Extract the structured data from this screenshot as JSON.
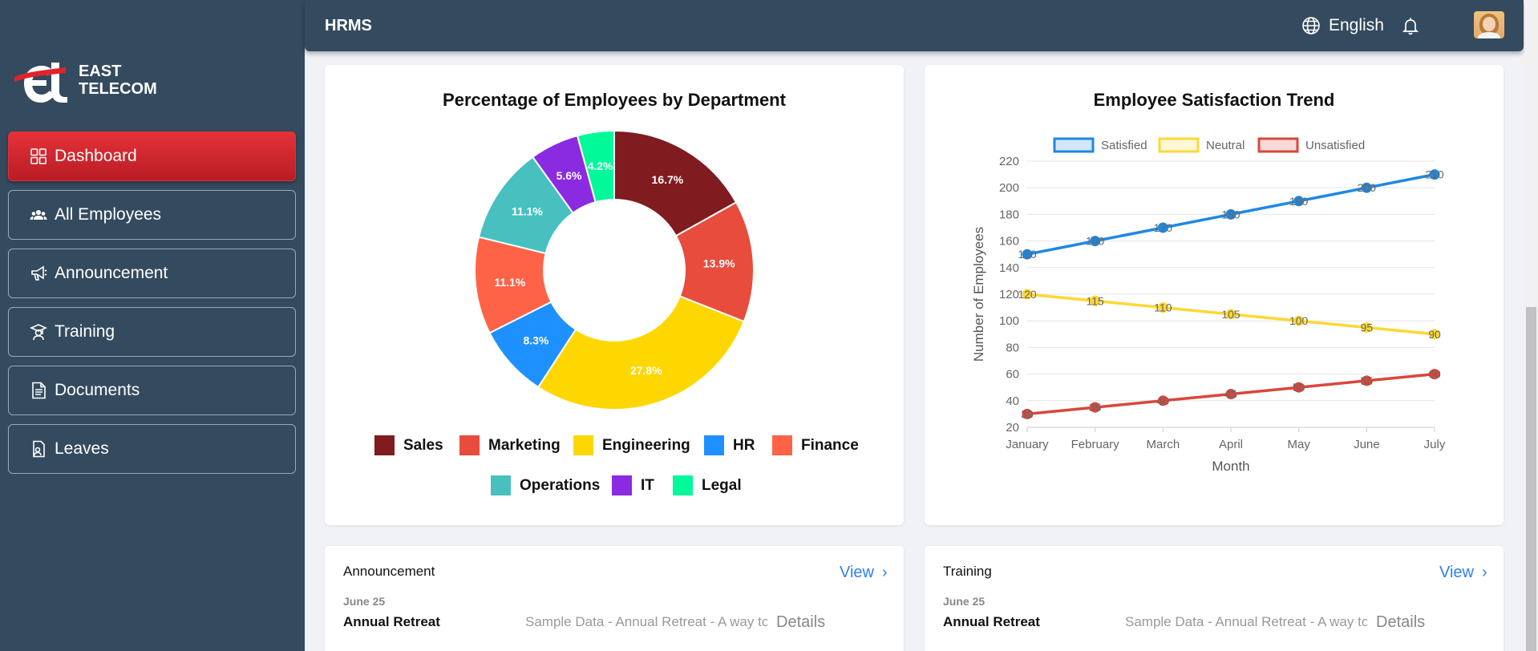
{
  "brand": {
    "line1": "EAST",
    "line2": "TELECOM",
    "accent": "#e2232a"
  },
  "sidebar": {
    "items": [
      {
        "label": "Dashboard",
        "icon": "grid-icon"
      },
      {
        "label": "All Employees",
        "icon": "users-icon"
      },
      {
        "label": "Announcement",
        "icon": "megaphone-icon"
      },
      {
        "label": "Training",
        "icon": "training-icon"
      },
      {
        "label": "Documents",
        "icon": "document-icon"
      },
      {
        "label": "Leaves",
        "icon": "leave-icon"
      }
    ]
  },
  "header": {
    "title": "HRMS",
    "language": "English"
  },
  "colors": {
    "sidebar_bg": "#344a5f",
    "active_red": "#d9252c",
    "link_blue": "#2f80ed"
  },
  "chart_data": [
    {
      "type": "pie",
      "title": "Percentage of Employees by Department",
      "categories": [
        "Sales",
        "Marketing",
        "Engineering",
        "HR",
        "Finance",
        "Operations",
        "IT",
        "Legal"
      ],
      "values": [
        16.7,
        13.9,
        27.8,
        8.3,
        11.1,
        11.1,
        5.6,
        4.2
      ],
      "labels": [
        "16.7%",
        "13.9%",
        "27.8%",
        "8.3%",
        "11.1%",
        "11.1%",
        "5.6%",
        "4.2%"
      ],
      "colors": [
        "#801b1f",
        "#e84c3d",
        "#ffd700",
        "#1e90ff",
        "#ff6347",
        "#48c0c0",
        "#8a2be2",
        "#00fa9a"
      ],
      "donut": true,
      "legend_position": "bottom"
    },
    {
      "type": "line",
      "title": "Employee Satisfaction Trend",
      "x": [
        "January",
        "February",
        "March",
        "April",
        "May",
        "June",
        "July"
      ],
      "series": [
        {
          "name": "Satisfied",
          "values": [
            150,
            160,
            170,
            180,
            190,
            200,
            210
          ],
          "color": "#1e88e5"
        },
        {
          "name": "Neutral",
          "values": [
            120,
            115,
            110,
            105,
            100,
            95,
            90
          ],
          "color": "#fdd835"
        },
        {
          "name": "Unsatisfied",
          "values": [
            30,
            35,
            40,
            45,
            50,
            55,
            60
          ],
          "color": "#d9473c"
        }
      ],
      "xlabel": "Month",
      "ylabel": "Number of Employees",
      "ylim": [
        20,
        220
      ],
      "yticks": [
        20,
        40,
        60,
        80,
        100,
        120,
        140,
        160,
        180,
        200,
        220
      ],
      "grid": true,
      "legend_position": "top"
    }
  ],
  "announcement": {
    "title": "Announcement",
    "view": "View",
    "items": [
      {
        "date": "June 25",
        "title": "Annual Retreat",
        "desc": "Sample Data - Annual Retreat - A way to",
        "details": "Details"
      }
    ]
  },
  "training": {
    "title": "Training",
    "view": "View",
    "items": [
      {
        "date": "June 25",
        "title": "Annual Retreat",
        "desc": "Sample Data - Annual Retreat - A way to",
        "details": "Details"
      }
    ]
  }
}
